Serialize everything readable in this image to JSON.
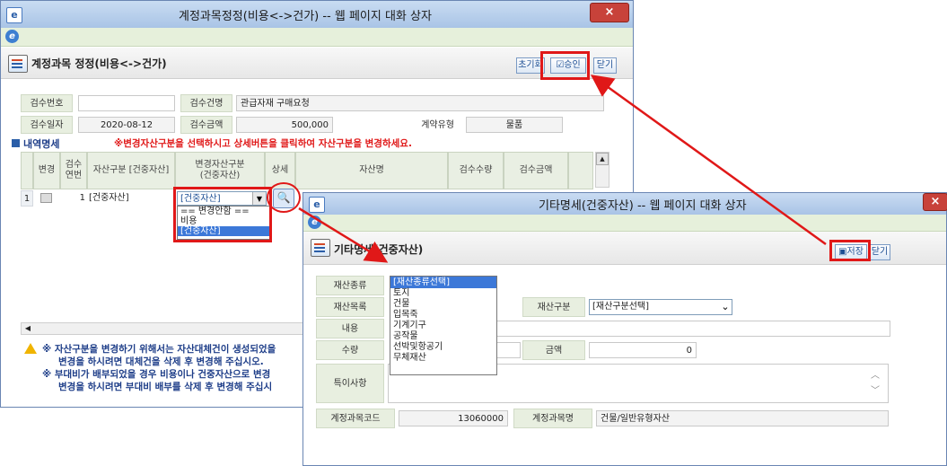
{
  "win1": {
    "title": "계정과목정정(비용<->건가) -- 웹 페이지 대화 상자",
    "close": "×",
    "header_title": "계정과목 정정(비용<->건가)",
    "buttons": {
      "reset": "초기화",
      "approve": "승인",
      "close": "닫기"
    },
    "form": {
      "inspection_no_label": "검수번호",
      "inspection_no": "",
      "inspection_name_label": "검수건명",
      "inspection_name": "관급자재 구매요청",
      "inspection_date_label": "검수일자",
      "inspection_date": "2020-08-12",
      "inspection_amount_label": "검수금액",
      "inspection_amount": "500,000",
      "contract_type_label": "계약유형",
      "contract_type": "물품"
    },
    "detail_label": "내역명세",
    "detail_notice": "※변경자산구분을 선택하시고 상세버튼을 클릭하여 자산구분을 변경하세요.",
    "columns": [
      "변경",
      "검수\n연번",
      "자산구분 [건중자산]",
      "변경자산구분\n(건중자산)",
      "상세",
      "자산명",
      "검수수량",
      "검수금액"
    ],
    "row": {
      "index": "1",
      "seq": "1",
      "asset_type": "[건중자산]",
      "selected": "[건중자산]"
    },
    "dropdown_options": [
      "== 변경안함 ==",
      "비용",
      "[건중자산]"
    ],
    "warning_lines": [
      "※ 자산구분을 변경하기 위해서는 자산대체건이 생성되었을",
      "변경을 하시려면 대체건을 삭제 후 변경해 주십시오.",
      "※ 부대비가 배부되었을 경우 비용이나 건중자산으로 변경",
      "변경을 하시려면 부대비 배부를 삭제 후 변경해 주십시"
    ]
  },
  "win2": {
    "title": "기타명세(건중자산) -- 웹 페이지 대화 상자",
    "close": "×",
    "header_title": "기타명세(건중자산)",
    "buttons": {
      "save": "저장",
      "close": "닫기"
    },
    "form": {
      "property_type_label": "재산종류",
      "property_item_label": "재산목록",
      "asset_class_label": "재산구분",
      "asset_class_value": "[재산구분선택]",
      "content_label": "내용",
      "quantity_label": "수량",
      "amount_label": "금액",
      "amount_value": "0",
      "remarks_label": "특이사항",
      "account_code_label": "계정과목코드",
      "account_code": "13060000",
      "account_name_label": "계정과목명",
      "account_name": "건물/일반유형자산"
    },
    "property_options": [
      "[재산종류선택]",
      "토지",
      "건물",
      "입목죽",
      "기계기구",
      "공작물",
      "선박및항공기",
      "무체재산"
    ]
  },
  "colors": {
    "accent_red": "#e01818",
    "label_bg": "#e8efe0",
    "highlight": "#3c78d8"
  }
}
